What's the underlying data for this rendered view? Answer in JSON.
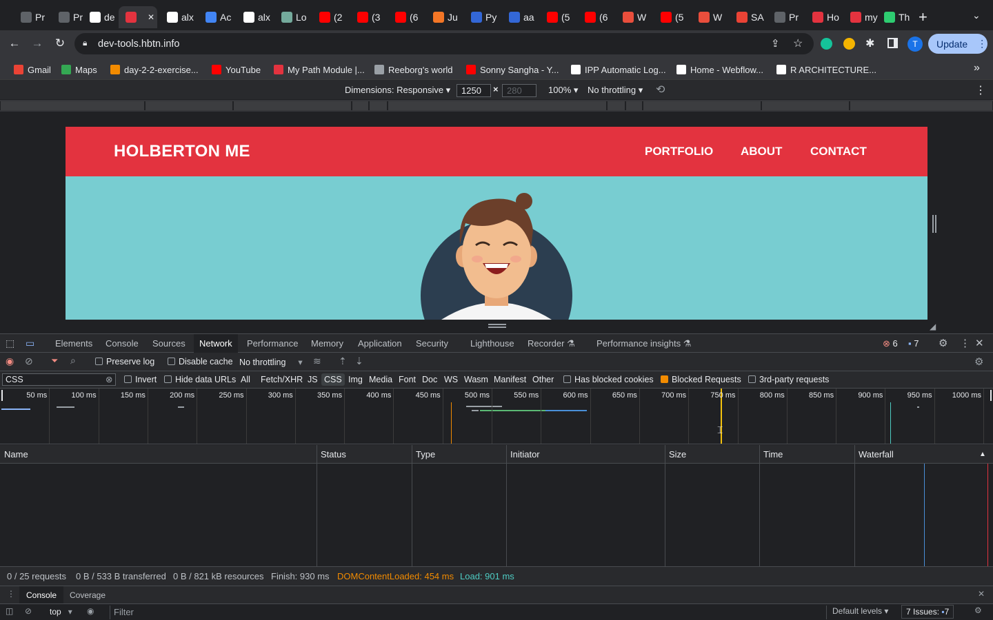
{
  "browser": {
    "tabs": [
      {
        "label": "Pr",
        "color": "#5f6368"
      },
      {
        "label": "Pr",
        "color": "#5f6368"
      },
      {
        "label": "de",
        "color": "#ffffff"
      },
      {
        "label": "",
        "color": "#e3333f"
      },
      {
        "label": "alx",
        "color": "#ffffff"
      },
      {
        "label": "Ac",
        "color": "#4285f4"
      },
      {
        "label": "alx",
        "color": "#ffffff"
      },
      {
        "label": "Lo",
        "color": "#74aa9c"
      },
      {
        "label": "(2",
        "color": "#ff0000"
      },
      {
        "label": "(3",
        "color": "#ff0000"
      },
      {
        "label": "(6",
        "color": "#ff0000"
      },
      {
        "label": "Ju",
        "color": "#f37626"
      },
      {
        "label": "Py",
        "color": "#3367d6"
      },
      {
        "label": "aa",
        "color": "#3367d6"
      },
      {
        "label": "(5",
        "color": "#ff0000"
      },
      {
        "label": "(6",
        "color": "#ff0000"
      },
      {
        "label": "W",
        "color": "#e94e3c"
      },
      {
        "label": "(5",
        "color": "#ff0000"
      },
      {
        "label": "W",
        "color": "#e94e3c"
      },
      {
        "label": "SA",
        "color": "#ea4335"
      },
      {
        "label": "Pr",
        "color": "#5f6368"
      },
      {
        "label": "Ho",
        "color": "#e3333f"
      },
      {
        "label": "my",
        "color": "#e3333f"
      },
      {
        "label": "Th",
        "color": "#2ecc71"
      }
    ],
    "new_tab": "+",
    "url": "dev-tools.hbtn.info",
    "update_label": "Update",
    "profile_initial": "T",
    "bookmarks": [
      {
        "label": "Gmail",
        "color": "#ea4335"
      },
      {
        "label": "Maps",
        "color": "#34a853"
      },
      {
        "label": "day-2-2-exercise...",
        "color": "#f28b00"
      },
      {
        "label": "YouTube",
        "color": "#ff0000"
      },
      {
        "label": "My Path Module |...",
        "color": "#e3333f"
      },
      {
        "label": "Reeborg's world",
        "color": "#9aa0a6"
      },
      {
        "label": "Sonny Sangha - Y...",
        "color": "#ff0000"
      },
      {
        "label": "IPP Automatic Log...",
        "color": "#ffffff"
      },
      {
        "label": "Home - Webflow...",
        "color": "#ffffff"
      },
      {
        "label": "R ARCHITECTURE...",
        "color": "#ffffff"
      }
    ],
    "more_bookmarks": "»"
  },
  "device_toolbar": {
    "dimensions_label": "Dimensions: Responsive ▾",
    "width_value": "1250",
    "times": "×",
    "height_placeholder": "280",
    "zoom": "100% ▾",
    "throttling": "No throttling ▾"
  },
  "site": {
    "logo": "HOLBERTON ME",
    "nav": [
      "PORTFOLIO",
      "ABOUT",
      "CONTACT"
    ],
    "header_color": "#e3333f",
    "hero_color": "#78cdd1"
  },
  "devtools": {
    "tabs": [
      "Elements",
      "Console",
      "Sources",
      "Network",
      "Performance",
      "Memory",
      "Application",
      "Security",
      "Lighthouse",
      "Recorder ⚗",
      "Performance insights ⚗"
    ],
    "active_tab": "Network",
    "errors_count": "6",
    "messages_count": "7",
    "network_toolbar": {
      "preserve_log": "Preserve log",
      "disable_cache": "Disable cache",
      "throttling": "No throttling"
    },
    "filter": {
      "value": "CSS",
      "invert": "Invert",
      "hide_data_urls": "Hide data URLs",
      "types": [
        "All",
        "Fetch/XHR",
        "JS",
        "CSS",
        "Img",
        "Media",
        "Font",
        "Doc",
        "WS",
        "Wasm",
        "Manifest",
        "Other"
      ],
      "active_type": "CSS",
      "has_blocked_cookies": "Has blocked cookies",
      "blocked_requests": "Blocked Requests",
      "third_party": "3rd-party requests"
    },
    "timeline_ticks": [
      "50 ms",
      "100 ms",
      "150 ms",
      "200 ms",
      "250 ms",
      "300 ms",
      "350 ms",
      "400 ms",
      "450 ms",
      "500 ms",
      "550 ms",
      "600 ms",
      "650 ms",
      "700 ms",
      "750 ms",
      "800 ms",
      "850 ms",
      "900 ms",
      "950 ms",
      "1000 ms"
    ],
    "columns": [
      "Name",
      "Status",
      "Type",
      "Initiator",
      "Size",
      "Time",
      "Waterfall"
    ],
    "status": {
      "requests": "0 / 25 requests",
      "transferred": "0 B / 533 B transferred",
      "resources": "0 B / 821 kB resources",
      "finish": "Finish: 930 ms",
      "dcl": "DOMContentLoaded: 454 ms",
      "load": "Load: 901 ms"
    },
    "drawer_tabs": [
      "Console",
      "Coverage"
    ],
    "console": {
      "context": "top",
      "filter_placeholder": "Filter",
      "levels": "Default levels ▾",
      "issues": "7 Issues:",
      "issues_count": "7"
    }
  }
}
